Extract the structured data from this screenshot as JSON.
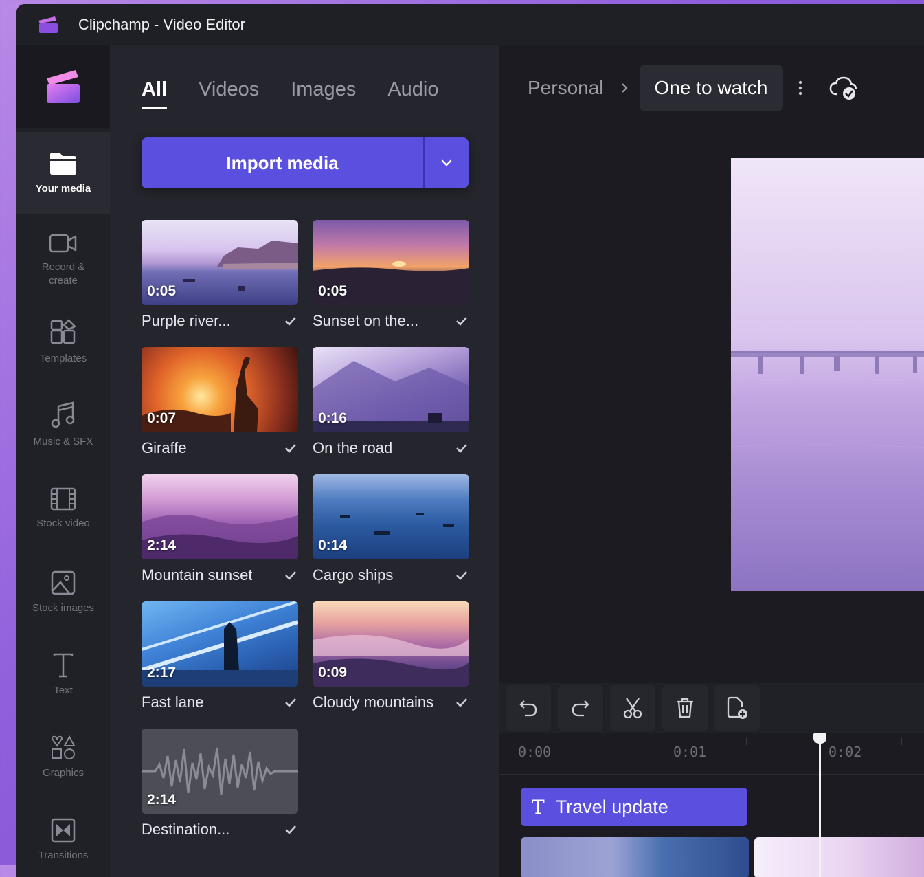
{
  "window": {
    "title": "Clipchamp - Video Editor"
  },
  "rail": {
    "items": [
      {
        "label": "Your media",
        "icon": "folder-icon",
        "active": true
      },
      {
        "label": "Record & create",
        "icon": "camera-icon"
      },
      {
        "label": "Templates",
        "icon": "templates-icon"
      },
      {
        "label": "Music & SFX",
        "icon": "music-icon"
      },
      {
        "label": "Stock video",
        "icon": "film-icon"
      },
      {
        "label": "Stock images",
        "icon": "image-icon"
      },
      {
        "label": "Text",
        "icon": "text-icon"
      },
      {
        "label": "Graphics",
        "icon": "shapes-icon"
      },
      {
        "label": "Transitions",
        "icon": "transitions-icon"
      }
    ]
  },
  "media": {
    "tabs": [
      "All",
      "Videos",
      "Images",
      "Audio"
    ],
    "active_tab": "All",
    "import_label": "Import media",
    "items": [
      {
        "name": "Purple river...",
        "duration": "0:05"
      },
      {
        "name": "Sunset on the...",
        "duration": "0:05"
      },
      {
        "name": "Giraffe",
        "duration": "0:07"
      },
      {
        "name": "On the road",
        "duration": "0:16"
      },
      {
        "name": "Mountain sunset",
        "duration": "2:14"
      },
      {
        "name": "Cargo ships",
        "duration": "0:14"
      },
      {
        "name": "Fast lane",
        "duration": "2:17"
      },
      {
        "name": "Cloudy mountains",
        "duration": "0:09"
      },
      {
        "name": "Destination...",
        "duration": "2:14"
      }
    ]
  },
  "header": {
    "breadcrumb_root": "Personal",
    "project_name": "One to watch"
  },
  "timeline": {
    "ticks": [
      "0:00",
      "0:01",
      "0:02"
    ],
    "text_clip": "Travel update"
  },
  "colors": {
    "accent": "#5b4fe0",
    "background": "#1b1b21",
    "panel": "#25252d"
  }
}
